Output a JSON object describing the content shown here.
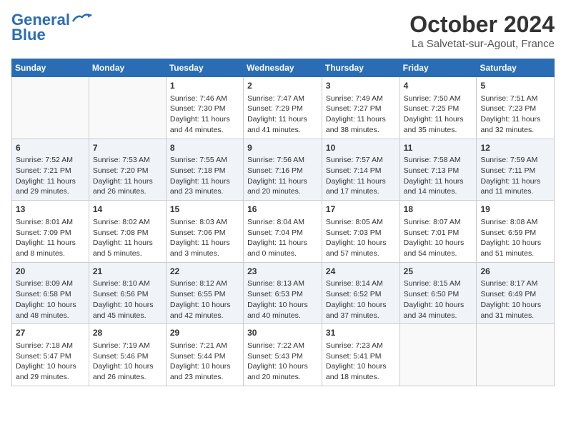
{
  "header": {
    "logo_line1": "General",
    "logo_line2": "Blue",
    "month": "October 2024",
    "location": "La Salvetat-sur-Agout, France"
  },
  "weekdays": [
    "Sunday",
    "Monday",
    "Tuesday",
    "Wednesday",
    "Thursday",
    "Friday",
    "Saturday"
  ],
  "weeks": [
    [
      {
        "day": null
      },
      {
        "day": null
      },
      {
        "day": "1",
        "sunrise": "Sunrise: 7:46 AM",
        "sunset": "Sunset: 7:30 PM",
        "daylight": "Daylight: 11 hours and 44 minutes."
      },
      {
        "day": "2",
        "sunrise": "Sunrise: 7:47 AM",
        "sunset": "Sunset: 7:29 PM",
        "daylight": "Daylight: 11 hours and 41 minutes."
      },
      {
        "day": "3",
        "sunrise": "Sunrise: 7:49 AM",
        "sunset": "Sunset: 7:27 PM",
        "daylight": "Daylight: 11 hours and 38 minutes."
      },
      {
        "day": "4",
        "sunrise": "Sunrise: 7:50 AM",
        "sunset": "Sunset: 7:25 PM",
        "daylight": "Daylight: 11 hours and 35 minutes."
      },
      {
        "day": "5",
        "sunrise": "Sunrise: 7:51 AM",
        "sunset": "Sunset: 7:23 PM",
        "daylight": "Daylight: 11 hours and 32 minutes."
      }
    ],
    [
      {
        "day": "6",
        "sunrise": "Sunrise: 7:52 AM",
        "sunset": "Sunset: 7:21 PM",
        "daylight": "Daylight: 11 hours and 29 minutes."
      },
      {
        "day": "7",
        "sunrise": "Sunrise: 7:53 AM",
        "sunset": "Sunset: 7:20 PM",
        "daylight": "Daylight: 11 hours and 26 minutes."
      },
      {
        "day": "8",
        "sunrise": "Sunrise: 7:55 AM",
        "sunset": "Sunset: 7:18 PM",
        "daylight": "Daylight: 11 hours and 23 minutes."
      },
      {
        "day": "9",
        "sunrise": "Sunrise: 7:56 AM",
        "sunset": "Sunset: 7:16 PM",
        "daylight": "Daylight: 11 hours and 20 minutes."
      },
      {
        "day": "10",
        "sunrise": "Sunrise: 7:57 AM",
        "sunset": "Sunset: 7:14 PM",
        "daylight": "Daylight: 11 hours and 17 minutes."
      },
      {
        "day": "11",
        "sunrise": "Sunrise: 7:58 AM",
        "sunset": "Sunset: 7:13 PM",
        "daylight": "Daylight: 11 hours and 14 minutes."
      },
      {
        "day": "12",
        "sunrise": "Sunrise: 7:59 AM",
        "sunset": "Sunset: 7:11 PM",
        "daylight": "Daylight: 11 hours and 11 minutes."
      }
    ],
    [
      {
        "day": "13",
        "sunrise": "Sunrise: 8:01 AM",
        "sunset": "Sunset: 7:09 PM",
        "daylight": "Daylight: 11 hours and 8 minutes."
      },
      {
        "day": "14",
        "sunrise": "Sunrise: 8:02 AM",
        "sunset": "Sunset: 7:08 PM",
        "daylight": "Daylight: 11 hours and 5 minutes."
      },
      {
        "day": "15",
        "sunrise": "Sunrise: 8:03 AM",
        "sunset": "Sunset: 7:06 PM",
        "daylight": "Daylight: 11 hours and 3 minutes."
      },
      {
        "day": "16",
        "sunrise": "Sunrise: 8:04 AM",
        "sunset": "Sunset: 7:04 PM",
        "daylight": "Daylight: 11 hours and 0 minutes."
      },
      {
        "day": "17",
        "sunrise": "Sunrise: 8:05 AM",
        "sunset": "Sunset: 7:03 PM",
        "daylight": "Daylight: 10 hours and 57 minutes."
      },
      {
        "day": "18",
        "sunrise": "Sunrise: 8:07 AM",
        "sunset": "Sunset: 7:01 PM",
        "daylight": "Daylight: 10 hours and 54 minutes."
      },
      {
        "day": "19",
        "sunrise": "Sunrise: 8:08 AM",
        "sunset": "Sunset: 6:59 PM",
        "daylight": "Daylight: 10 hours and 51 minutes."
      }
    ],
    [
      {
        "day": "20",
        "sunrise": "Sunrise: 8:09 AM",
        "sunset": "Sunset: 6:58 PM",
        "daylight": "Daylight: 10 hours and 48 minutes."
      },
      {
        "day": "21",
        "sunrise": "Sunrise: 8:10 AM",
        "sunset": "Sunset: 6:56 PM",
        "daylight": "Daylight: 10 hours and 45 minutes."
      },
      {
        "day": "22",
        "sunrise": "Sunrise: 8:12 AM",
        "sunset": "Sunset: 6:55 PM",
        "daylight": "Daylight: 10 hours and 42 minutes."
      },
      {
        "day": "23",
        "sunrise": "Sunrise: 8:13 AM",
        "sunset": "Sunset: 6:53 PM",
        "daylight": "Daylight: 10 hours and 40 minutes."
      },
      {
        "day": "24",
        "sunrise": "Sunrise: 8:14 AM",
        "sunset": "Sunset: 6:52 PM",
        "daylight": "Daylight: 10 hours and 37 minutes."
      },
      {
        "day": "25",
        "sunrise": "Sunrise: 8:15 AM",
        "sunset": "Sunset: 6:50 PM",
        "daylight": "Daylight: 10 hours and 34 minutes."
      },
      {
        "day": "26",
        "sunrise": "Sunrise: 8:17 AM",
        "sunset": "Sunset: 6:49 PM",
        "daylight": "Daylight: 10 hours and 31 minutes."
      }
    ],
    [
      {
        "day": "27",
        "sunrise": "Sunrise: 7:18 AM",
        "sunset": "Sunset: 5:47 PM",
        "daylight": "Daylight: 10 hours and 29 minutes."
      },
      {
        "day": "28",
        "sunrise": "Sunrise: 7:19 AM",
        "sunset": "Sunset: 5:46 PM",
        "daylight": "Daylight: 10 hours and 26 minutes."
      },
      {
        "day": "29",
        "sunrise": "Sunrise: 7:21 AM",
        "sunset": "Sunset: 5:44 PM",
        "daylight": "Daylight: 10 hours and 23 minutes."
      },
      {
        "day": "30",
        "sunrise": "Sunrise: 7:22 AM",
        "sunset": "Sunset: 5:43 PM",
        "daylight": "Daylight: 10 hours and 20 minutes."
      },
      {
        "day": "31",
        "sunrise": "Sunrise: 7:23 AM",
        "sunset": "Sunset: 5:41 PM",
        "daylight": "Daylight: 10 hours and 18 minutes."
      },
      {
        "day": null
      },
      {
        "day": null
      }
    ]
  ]
}
